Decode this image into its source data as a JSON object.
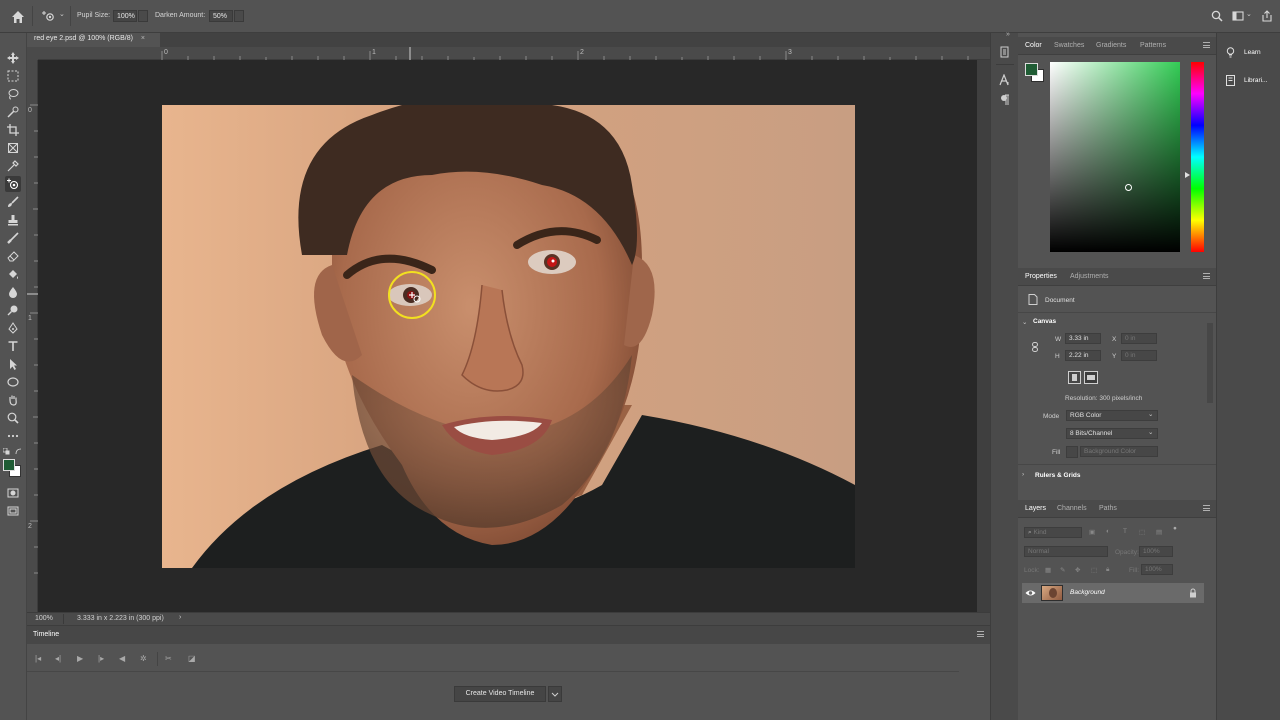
{
  "options_bar": {
    "pupil_size_label": "Pupil Size:",
    "pupil_size_value": "100%",
    "darken_amount_label": "Darken Amount:",
    "darken_amount_value": "50%"
  },
  "document": {
    "tab_title": "red eye 2.psd @ 100% (RGB/8)",
    "close_glyph": "×",
    "ruler_h": [
      "0",
      "1",
      "2",
      "3"
    ],
    "ruler_v": [
      "0",
      "1",
      "2"
    ]
  },
  "status": {
    "zoom": "100%",
    "doc_size": "3.333 in x 2.223 in (300 ppi)",
    "arrow": "›"
  },
  "timeline": {
    "title": "Timeline",
    "create_button": "Create Video Timeline"
  },
  "color_panel": {
    "tabs": [
      "Color",
      "Swatches",
      "Gradients",
      "Patterns"
    ],
    "foreground": "#1f5c34",
    "background": "#ffffff",
    "hue": "#33cc55"
  },
  "properties_panel": {
    "tabs": [
      "Properties",
      "Adjustments"
    ],
    "document_label": "Document",
    "canvas_label": "Canvas",
    "w_label": "W",
    "w_value": "3.33 in",
    "h_label": "H",
    "h_value": "2.22 in",
    "x_label": "X",
    "x_value": "0 in",
    "y_label": "Y",
    "y_value": "0 in",
    "resolution": "Resolution: 300 pixels/inch",
    "mode_label": "Mode",
    "mode_value": "RGB Color",
    "bits_value": "8 Bits/Channel",
    "fill_label": "Fill",
    "fill_value": "Background Color",
    "rulers_label": "Rulers & Grids"
  },
  "layers_panel": {
    "tabs": [
      "Layers",
      "Channels",
      "Paths"
    ],
    "kind_placeholder": "Kind",
    "blend_mode": "Normal",
    "opacity_label": "Opacity:",
    "opacity_value": "100%",
    "lock_label": "Lock:",
    "fill_label": "Fill:",
    "fill_value": "100%",
    "layer_name": "Background"
  },
  "learn_column": {
    "learn": "Learn",
    "libraries": "Librari..."
  }
}
